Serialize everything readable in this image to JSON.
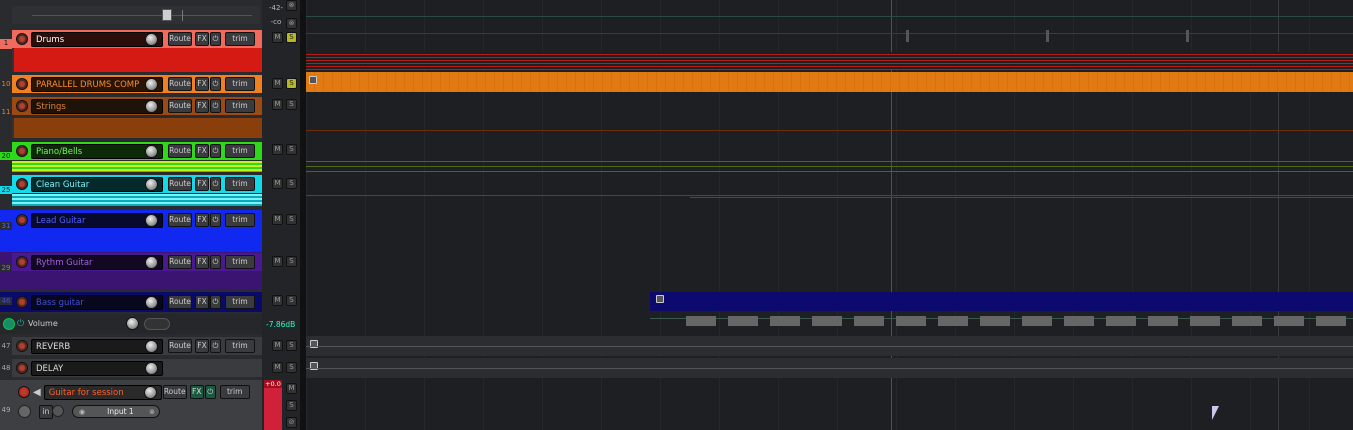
{
  "top_meter": {
    "peak": "-42-",
    "minus_inf": "-co"
  },
  "tracks": [
    {
      "num": "1",
      "name": "Drums",
      "color": "#f06a5e",
      "name_bg": "#2a0e0b",
      "name_fg": "#ffffff"
    },
    {
      "num": "10",
      "name": "PARALLEL DRUMS COMP",
      "color": "#f08020",
      "name_bg": "#2a1505",
      "name_fg": "#ff8a30"
    },
    {
      "num": "11",
      "name": "Strings",
      "color": "#9a4a12",
      "name_bg": "#1f1208",
      "name_fg": "#e08030"
    },
    {
      "num": "20",
      "name": "Piano/Bells",
      "color": "#2ed81a",
      "name_bg": "#0c2a08",
      "name_fg": "#7ef060"
    },
    {
      "num": "25",
      "name": "Clean Guitar",
      "color": "#12dae8",
      "name_bg": "#062a2c",
      "name_fg": "#7af2fa"
    },
    {
      "num": "31",
      "name": "Lead Guitar",
      "color": "#1028f0",
      "name_bg": "#070a2c",
      "name_fg": "#5060ff"
    },
    {
      "num": "29",
      "name": "Rythm Guitar",
      "color": "#4a1890",
      "name_bg": "#130822",
      "name_fg": "#a060e0"
    },
    {
      "num": "46",
      "name": "Bass guitar",
      "color": "#0a0a6a",
      "name_bg": "#07071e",
      "name_fg": "#4050d0"
    }
  ],
  "envelope": {
    "label": "Volume",
    "value": "-7.86dB"
  },
  "sends": [
    {
      "num": "47",
      "name": "REVERB"
    },
    {
      "num": "48",
      "name": "DELAY"
    }
  ],
  "record_track": {
    "num": "49",
    "name": "Guitar for session",
    "input_label": "Input 1",
    "meter_value": "+0.0"
  },
  "buttons": {
    "route": "Route",
    "fx": "FX",
    "trim": "trim",
    "mute": "M",
    "solo": "S",
    "in": "in"
  }
}
